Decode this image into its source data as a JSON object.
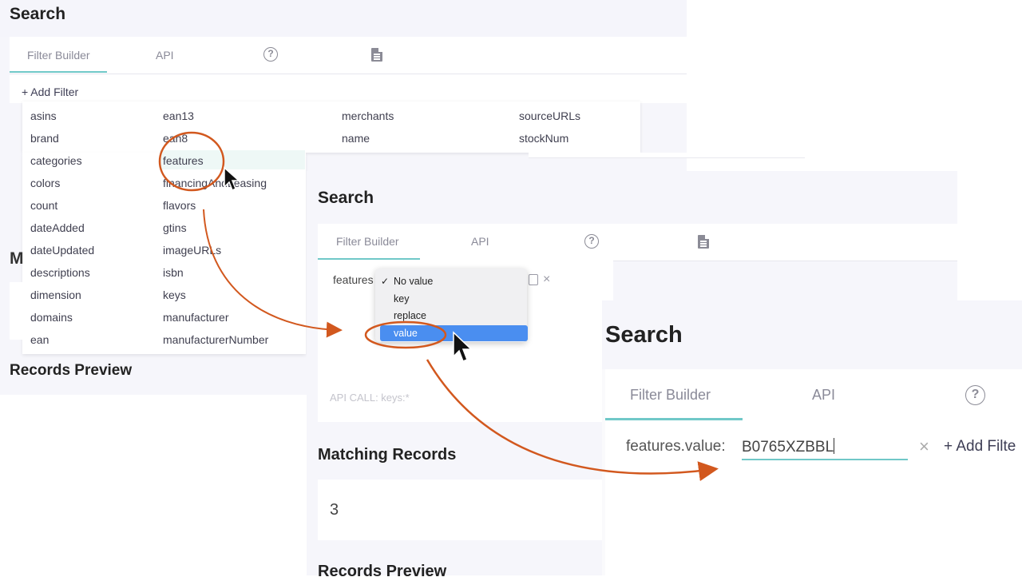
{
  "panel1": {
    "title": "Search",
    "tabs": [
      "Filter Builder",
      "API"
    ],
    "add_filter": "+ Add Filter",
    "options_col1": [
      "asins",
      "brand",
      "categories",
      "colors",
      "count",
      "dateAdded",
      "dateUpdated",
      "descriptions",
      "dimension",
      "domains",
      "ean"
    ],
    "options_col2": [
      "ean13",
      "ean8",
      "features",
      "financingAndLeasing",
      "flavors",
      "gtins",
      "imageURLs",
      "isbn",
      "keys",
      "manufacturer",
      "manufacturerNumber"
    ],
    "options_col3": [
      "merchants",
      "name"
    ],
    "options_col4": [
      "sourceURLs",
      "stockNum"
    ],
    "partial_heading": "M",
    "records_preview": "Records Preview"
  },
  "panel2": {
    "title": "Search",
    "tabs": [
      "Filter Builder",
      "API"
    ],
    "filter_key": "features",
    "menu": [
      "No value",
      "key",
      "replace",
      "value"
    ],
    "checkmark": "✓",
    "close": "×",
    "api_call": "API CALL: keys:*",
    "matching_title": "Matching Records",
    "count": "3",
    "records_preview": "Records Preview"
  },
  "panel3": {
    "title": "Search",
    "tabs": [
      "Filter Builder",
      "API"
    ],
    "filter_label": "features.value:",
    "filter_value": "B0765XZBBL",
    "close": "×",
    "add_filter": "+ Add Filte"
  },
  "icons": {
    "help": "question-circle",
    "doc": "document",
    "cursor": "mouse-pointer"
  },
  "colors": {
    "accent_teal": "#70c8c8",
    "annotation": "#d2581e",
    "menu_selected": "#4a8ef0"
  }
}
